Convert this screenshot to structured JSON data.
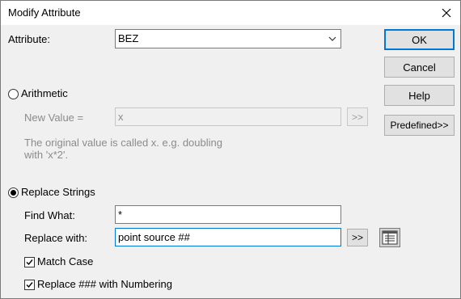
{
  "window": {
    "title": "Modify Attribute"
  },
  "attribute": {
    "label": "Attribute:",
    "value": "BEZ"
  },
  "buttons": {
    "ok": "OK",
    "cancel": "Cancel",
    "help": "Help",
    "predefined": "Predefined>>"
  },
  "arithmetic": {
    "label": "Arithmetic",
    "selected": false,
    "new_value_label": "New Value =",
    "new_value": "x",
    "expand_label": ">>",
    "note": "The original value is called x. e.g. doubling with 'x*2'."
  },
  "replace": {
    "label": "Replace Strings",
    "selected": true,
    "find_label": "Find What:",
    "find_value": "*",
    "replace_label": "Replace with:",
    "replace_value": "point source ##",
    "expand_label": ">>",
    "match_case_label": "Match Case",
    "match_case": true,
    "numbering_label": "Replace ### with Numbering",
    "numbering": true
  },
  "icons": {
    "close": "close-icon",
    "chevron": "chevron-down-icon",
    "picker": "field-picker-icon",
    "check": "check-icon"
  }
}
